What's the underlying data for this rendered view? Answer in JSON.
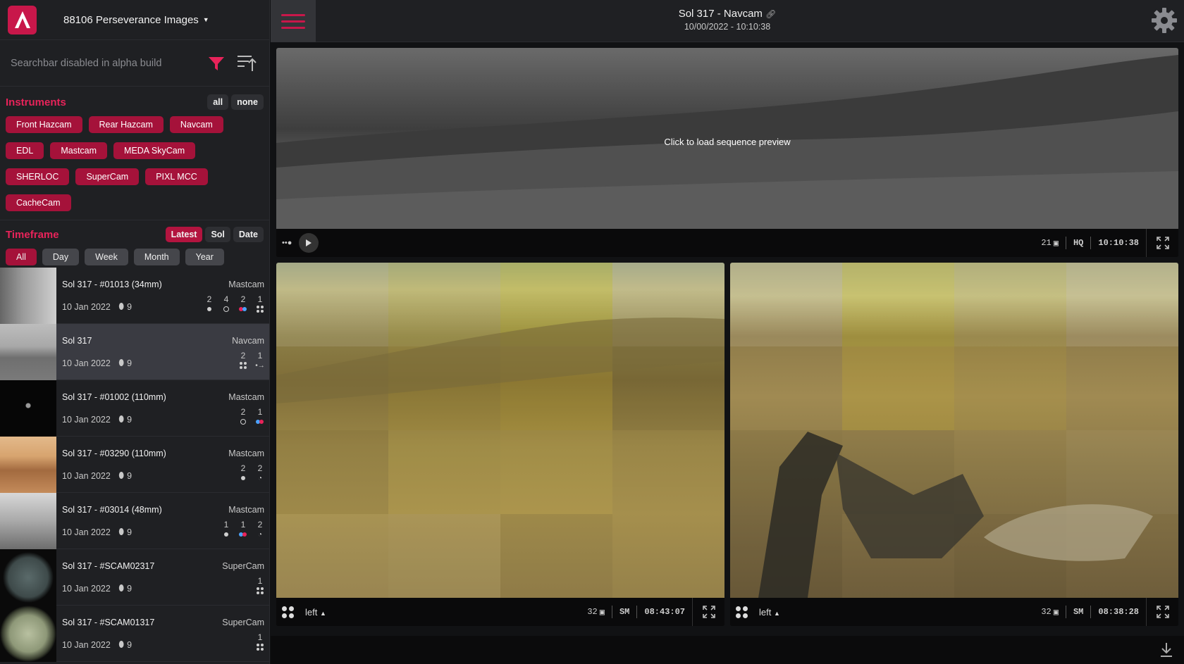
{
  "app": {
    "title": "88106 Perseverance Images"
  },
  "search": {
    "placeholder": "Searchbar disabled in alpha build"
  },
  "instruments": {
    "title": "Instruments",
    "all_label": "all",
    "none_label": "none",
    "chips": [
      "Front Hazcam",
      "Rear Hazcam",
      "Navcam",
      "EDL",
      "Mastcam",
      "MEDA SkyCam",
      "SHERLOC",
      "SuperCam",
      "PIXL MCC",
      "CacheCam"
    ]
  },
  "timeframe": {
    "title": "Timeframe",
    "modes": [
      "Latest",
      "Sol",
      "Date"
    ],
    "active_mode": "Latest",
    "ranges": [
      "All",
      "Day",
      "Week",
      "Month",
      "Year"
    ],
    "active_range": "All"
  },
  "list": [
    {
      "title": "Sol 317 - #01013 (34mm)",
      "instrument": "Mastcam",
      "date": "10 Jan 2022",
      "pins": "9",
      "counts": [
        "2",
        "4",
        "2",
        "1"
      ]
    },
    {
      "title": "Sol 317",
      "instrument": "Navcam",
      "date": "10 Jan 2022",
      "pins": "9",
      "counts": [
        "2",
        "1"
      ]
    },
    {
      "title": "Sol 317 - #01002 (110mm)",
      "instrument": "Mastcam",
      "date": "10 Jan 2022",
      "pins": "9",
      "counts": [
        "2",
        "1"
      ]
    },
    {
      "title": "Sol 317 - #03290 (110mm)",
      "instrument": "Mastcam",
      "date": "10 Jan 2022",
      "pins": "9",
      "counts": [
        "2",
        "2"
      ]
    },
    {
      "title": "Sol 317 - #03014 (48mm)",
      "instrument": "Mastcam",
      "date": "10 Jan 2022",
      "pins": "9",
      "counts": [
        "1",
        "1",
        "2"
      ]
    },
    {
      "title": "Sol 317 - #SCAM02317",
      "instrument": "SuperCam",
      "date": "10 Jan 2022",
      "pins": "9",
      "counts": [
        "1"
      ]
    },
    {
      "title": "Sol 317 - #SCAM01317",
      "instrument": "SuperCam",
      "date": "10 Jan 2022",
      "pins": "9",
      "counts": [
        "1"
      ]
    }
  ],
  "header": {
    "title": "Sol 317 - Navcam",
    "subtitle": "10/00/2022 - 10:10:38"
  },
  "main_viewer": {
    "overlay": "Click to load sequence preview",
    "frames": "21",
    "quality": "HQ",
    "time": "10:10:38"
  },
  "left_viewer": {
    "eye": "left",
    "frames": "32",
    "quality": "SM",
    "time": "08:43:07"
  },
  "right_viewer": {
    "eye": "left",
    "frames": "32",
    "quality": "SM",
    "time": "08:38:28"
  },
  "colors": {
    "accent": "#c8174a",
    "chip": "#a5123a",
    "sidebar": "#1f2023"
  }
}
